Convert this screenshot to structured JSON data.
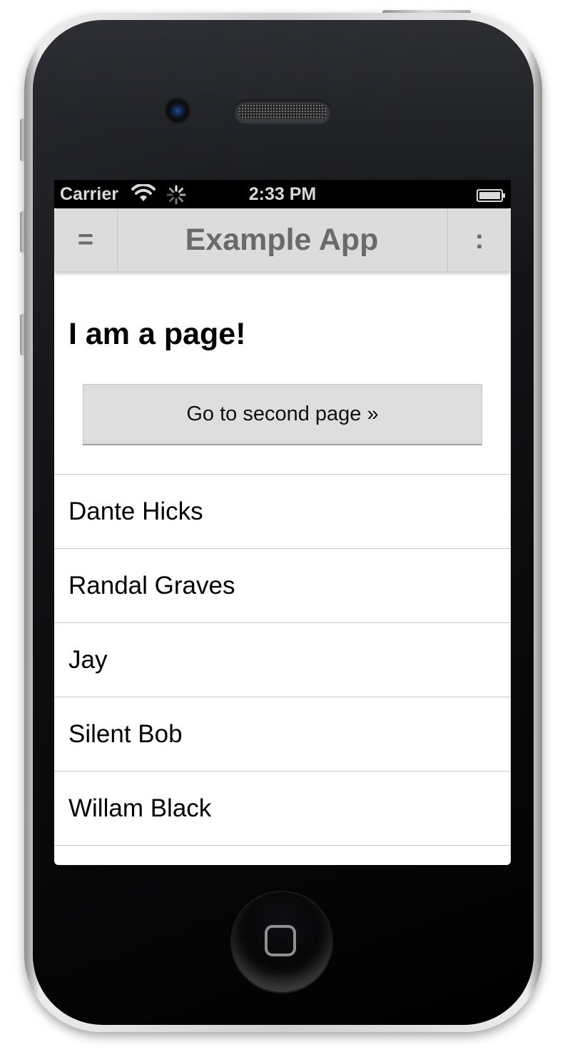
{
  "status_bar": {
    "carrier": "Carrier",
    "time": "2:33 PM",
    "icons": [
      "wifi-icon",
      "activity-spinner-icon",
      "battery-icon"
    ]
  },
  "navbar": {
    "menu_label": "=",
    "title": "Example App",
    "more_label": ":"
  },
  "page": {
    "heading": "I am a page!",
    "button_label": "Go to second page »"
  },
  "list_items": [
    "Dante Hicks",
    "Randal Graves",
    "Jay",
    "Silent Bob",
    "Willam Black"
  ],
  "colors": {
    "navbar_bg": "#dcdcdc",
    "navbar_text": "#6a6a6a",
    "button_bg": "#dedede",
    "status_bar_bg": "#000000"
  }
}
